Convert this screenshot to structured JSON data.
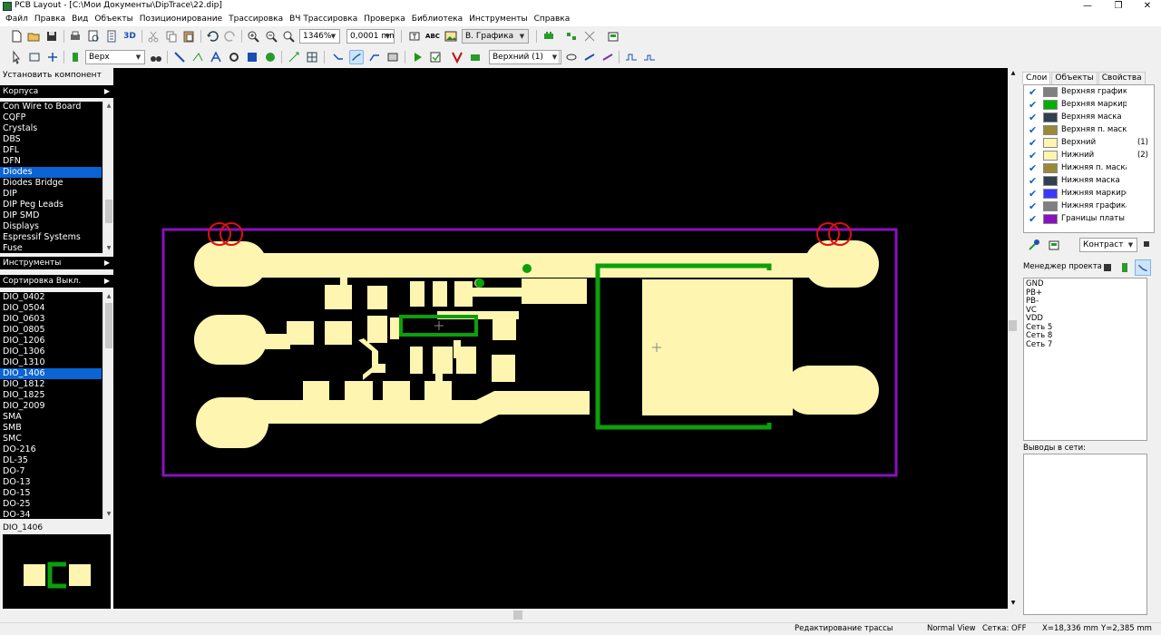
{
  "window": {
    "title": "PCB Layout - [C:\\Мои Документы\\DipTrace\\22.dip]",
    "minimize": "—",
    "maximize": "❐",
    "close": "✕"
  },
  "menu": [
    "Файл",
    "Правка",
    "Вид",
    "Объекты",
    "Позиционирование",
    "Трассировка",
    "ВЧ Трассировка",
    "Проверка",
    "Библиотека",
    "Инструменты",
    "Справка"
  ],
  "toolbar1": {
    "zoom_value": "1346%",
    "grid_value": "0,0001 mm",
    "layer_mode": "В. Графика",
    "label_3d": "3D"
  },
  "toolbar2": {
    "side_value": "Верх",
    "layer_value": "Верхний (1)"
  },
  "left_panel": {
    "install_component": "Установить компонент",
    "cases_header": "Корпуса",
    "cases": [
      "Con Wire to Board",
      "CQFP",
      "Crystals",
      "DBS",
      "DFL",
      "DFN",
      "Diodes",
      "Diodes Bridge",
      "DIP",
      "DIP Peg Leads",
      "DIP SMD",
      "Displays",
      "Espressif Systems",
      "Fuse"
    ],
    "cases_selected": "Diodes",
    "tools_header": "Инструменты",
    "sort_header": "Сортировка Выкл.",
    "components": [
      "DIO_0402",
      "DIO_0504",
      "DIO_0603",
      "DIO_0805",
      "DIO_1206",
      "DIO_1306",
      "DIO_1310",
      "DIO_1406",
      "DIO_1812",
      "DIO_1825",
      "DIO_2009",
      "SMA",
      "SMB",
      "SMC",
      "DO-216",
      "DL-35",
      "DO-7",
      "DO-13",
      "DO-15",
      "DO-25",
      "DO-34"
    ],
    "components_selected": "DIO_1406",
    "preview_label": "DIO_1406"
  },
  "right_panel": {
    "tabs": [
      "Слои",
      "Объекты",
      "Свойства"
    ],
    "active_tab": "Слои",
    "layers": [
      {
        "name": "Верхняя графика",
        "num": "",
        "color": "#808080"
      },
      {
        "name": "Верхняя маркировка",
        "num": "",
        "color": "#00b000"
      },
      {
        "name": "Верхняя маска",
        "num": "",
        "color": "#2f4050"
      },
      {
        "name": "Верхняя п. маска",
        "num": "",
        "color": "#9a8a38"
      },
      {
        "name": "Верхний",
        "num": "(1)",
        "color": "#fdf5b0"
      },
      {
        "name": "Нижний",
        "num": "(2)",
        "color": "#fdf5b0"
      },
      {
        "name": "Нижняя п. маска",
        "num": "",
        "color": "#9a8a38"
      },
      {
        "name": "Нижняя маска",
        "num": "",
        "color": "#2f4050"
      },
      {
        "name": "Нижняя маркировка",
        "num": "",
        "color": "#3a3aff"
      },
      {
        "name": "Нижняя графика",
        "num": "",
        "color": "#808080"
      },
      {
        "name": "Границы платы",
        "num": "",
        "color": "#8a10c0"
      }
    ],
    "contrast_value": "Контраст",
    "project_manager": "Менеджер проекта",
    "nets": [
      "GND",
      "PB+",
      "PB-",
      "VC",
      "VDD",
      "Сеть 5",
      "Сеть 8",
      "Сеть 7"
    ],
    "pins_header": "Выводы в сети:"
  },
  "colors": {
    "copper": "#fdf5b0",
    "silkscreen": "#0aa00a",
    "board_outline": "#8a10c0",
    "hole_circle": "#e01010"
  },
  "status": {
    "mode": "Редактирование трассы",
    "view": "Normal View",
    "grid": "Сетка: OFF",
    "x": "X=18,336 mm",
    "y": "Y=2,385 mm"
  }
}
